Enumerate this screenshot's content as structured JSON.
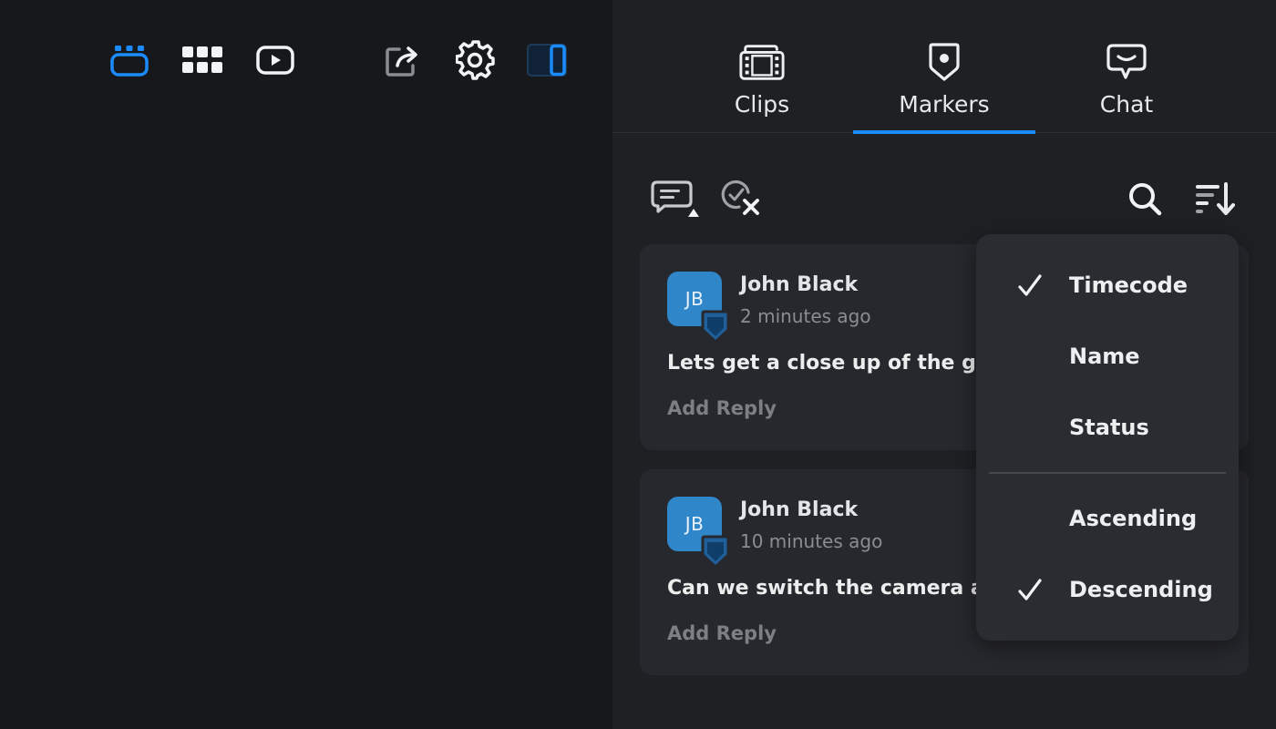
{
  "toolbar": {
    "icons": [
      "layout-icon",
      "grid-icon",
      "play-icon",
      "share-icon",
      "settings-icon",
      "sidebar-toggle-icon"
    ],
    "accent_color": "#1a8cff"
  },
  "tabs": [
    {
      "label": "Clips",
      "icon": "clips-icon",
      "active": false
    },
    {
      "label": "Markers",
      "icon": "marker-icon",
      "active": true
    },
    {
      "label": "Chat",
      "icon": "chat-icon",
      "active": false
    }
  ],
  "marker_tools": {
    "icons": [
      "add-comment-icon",
      "clear-resolved-icon",
      "search-icon",
      "sort-icon"
    ]
  },
  "comments": [
    {
      "initials": "JB",
      "author": "John Black",
      "time": "2 minutes ago",
      "text": "Lets get a close up of the goal",
      "reply_label": "Add Reply"
    },
    {
      "initials": "JB",
      "author": "John Black",
      "time": "10 minutes ago",
      "text": "Can we switch the camera angle",
      "reply_label": "Add Reply"
    }
  ],
  "sort_menu": {
    "fields": [
      {
        "label": "Timecode",
        "checked": true
      },
      {
        "label": "Name",
        "checked": false
      },
      {
        "label": "Status",
        "checked": false
      }
    ],
    "orders": [
      {
        "label": "Ascending",
        "checked": false
      },
      {
        "label": "Descending",
        "checked": true
      }
    ]
  }
}
